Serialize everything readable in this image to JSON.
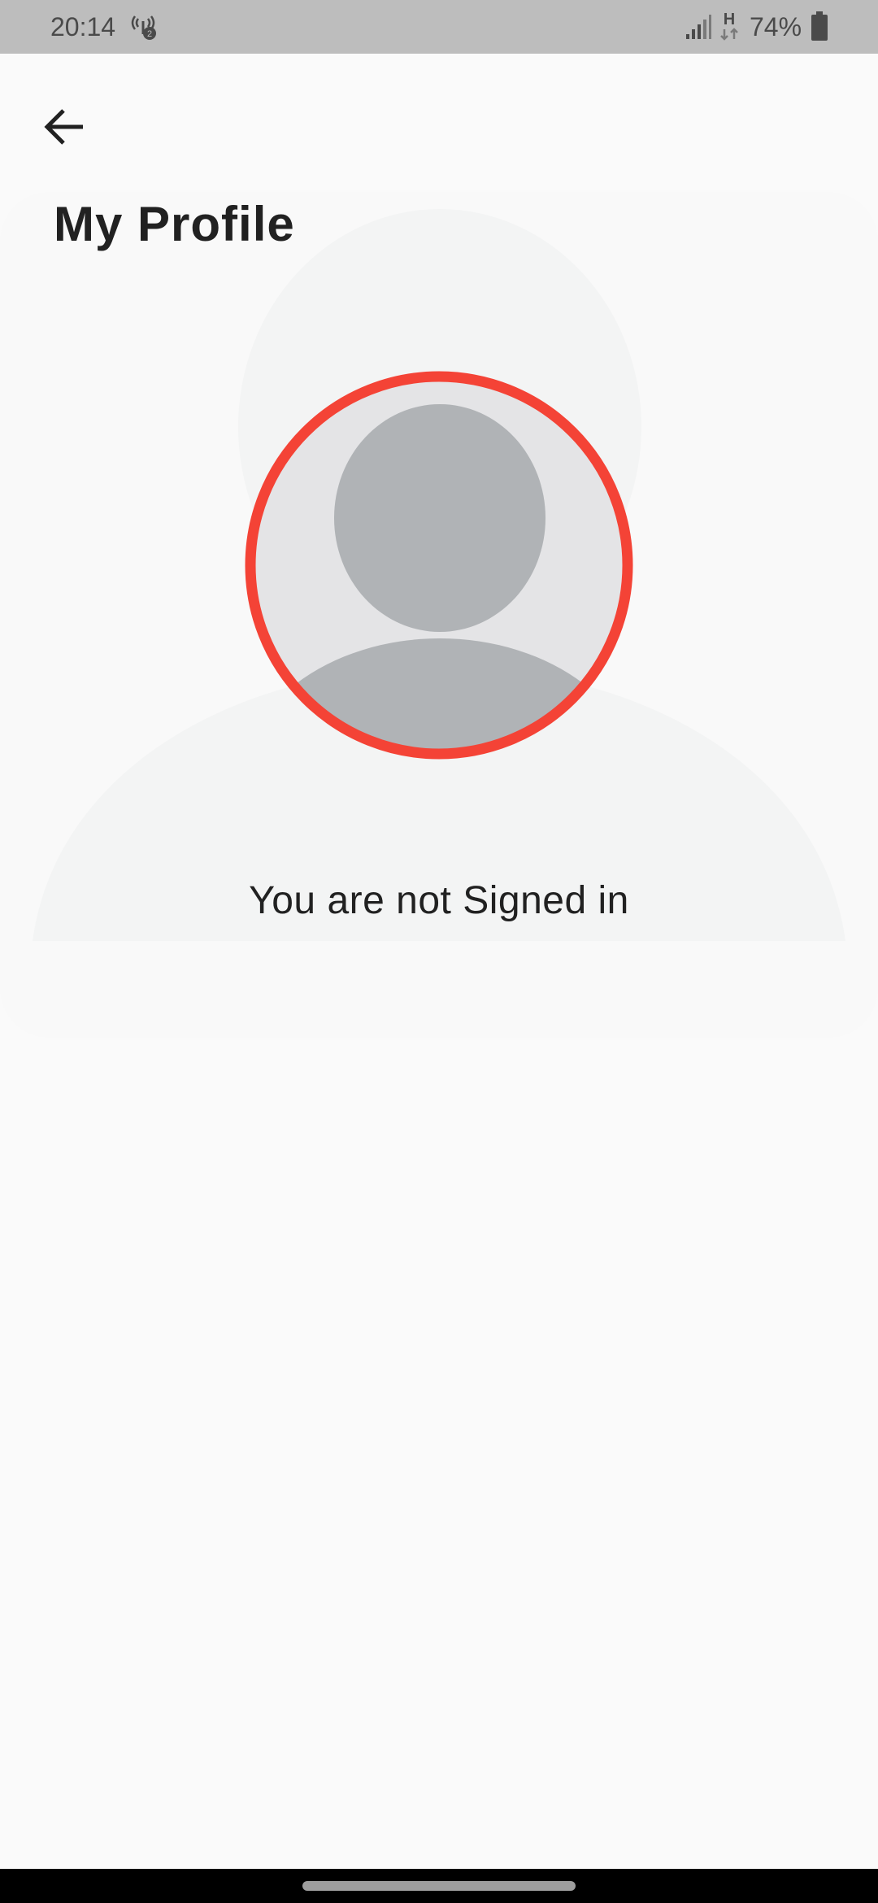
{
  "status_bar": {
    "time": "20:14",
    "battery_percent": "74%",
    "hotspot_icon": "portable-hotspot-icon",
    "hotspot_badge": "2",
    "signal_icon": "cell-signal-icon",
    "network_type": "H",
    "battery_icon": "battery-icon"
  },
  "header": {
    "back_icon": "arrow-back-icon",
    "title": "My Profile"
  },
  "profile": {
    "avatar_icon": "default-avatar-icon",
    "signin_status": "You are not Signed in"
  },
  "colors": {
    "avatar_ring": "#f44336",
    "avatar_fill": "#e4e4e6",
    "avatar_figure": "#b0b3b6",
    "silhouette_bg": "#f3f4f4",
    "page_bg": "#fafafa",
    "status_bar_bg": "#bdbdbd"
  }
}
